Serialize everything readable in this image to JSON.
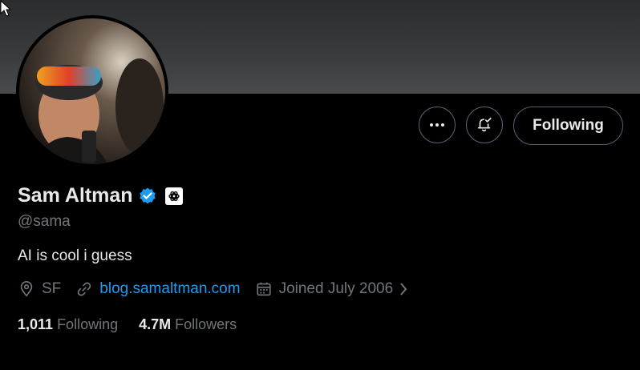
{
  "profile": {
    "name": "Sam Altman",
    "handle": "@sama",
    "bio": "AI is cool i guess",
    "location": "SF",
    "website": "blog.samaltman.com",
    "joined": "Joined July 2006",
    "following_count": "1,011",
    "following_label": "Following",
    "followers_count": "4.7M",
    "followers_label": "Followers"
  },
  "actions": {
    "follow_label": "Following"
  },
  "icons": {
    "more": "more-dots-icon",
    "notify": "bell-check-icon",
    "verified": "verified-badge-icon",
    "affiliation": "openai-logo-icon",
    "location": "location-pin-icon",
    "link": "link-icon",
    "calendar": "calendar-icon",
    "chevron": "chevron-right-icon"
  },
  "colors": {
    "background": "#000000",
    "text": "#e7e9ea",
    "secondary": "#71767b",
    "accent": "#1d9bf0",
    "border": "#536471"
  }
}
